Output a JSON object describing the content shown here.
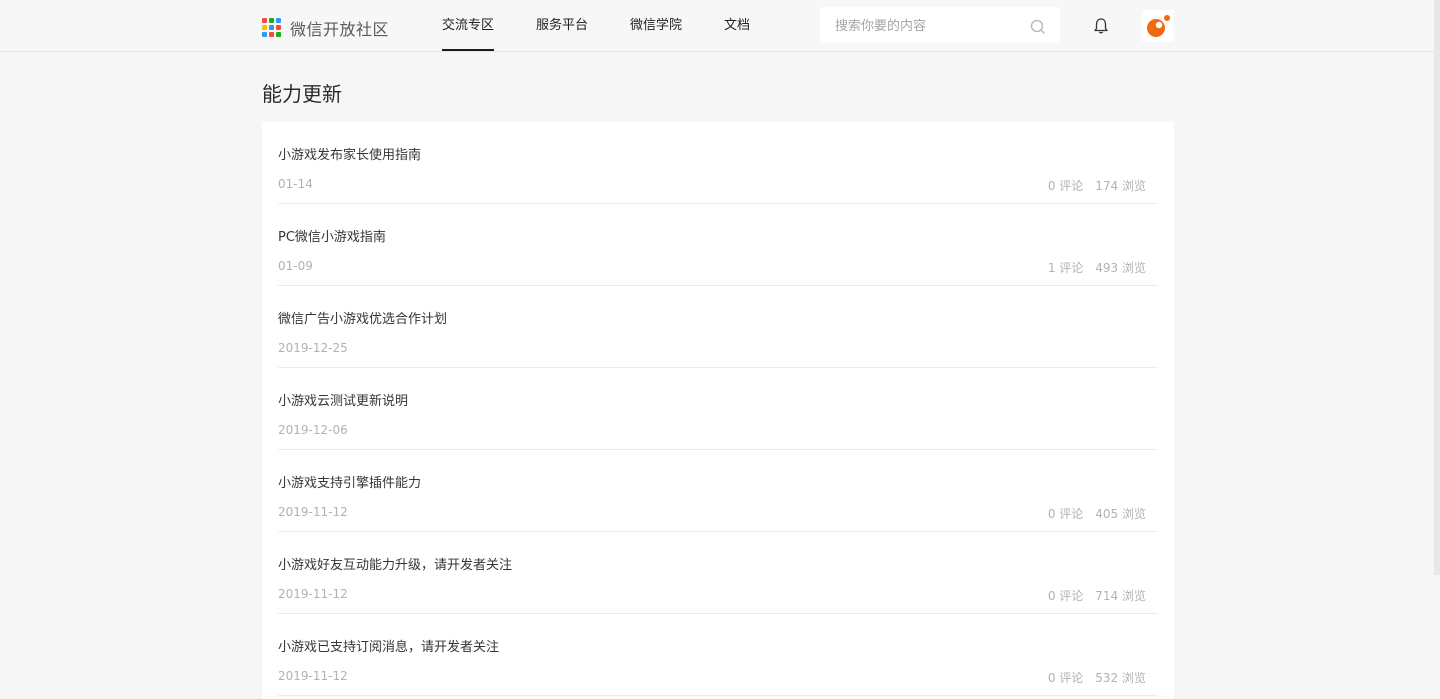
{
  "header": {
    "logo_text": "微信开放社区",
    "nav": [
      "交流专区",
      "服务平台",
      "微信学院",
      "文档"
    ],
    "search_placeholder": "搜索你要的内容"
  },
  "page": {
    "title": "能力更新"
  },
  "posts": [
    {
      "title": "小游戏发布家长使用指南",
      "date": "01-14",
      "comments": "0 评论",
      "views": "174 浏览"
    },
    {
      "title": "PC微信小游戏指南",
      "date": "01-09",
      "comments": "1 评论",
      "views": "493 浏览"
    },
    {
      "title": "微信广告小游戏优选合作计划",
      "date": "2019-12-25",
      "comments": "",
      "views": ""
    },
    {
      "title": "小游戏云测试更新说明",
      "date": "2019-12-06",
      "comments": "",
      "views": ""
    },
    {
      "title": "小游戏支持引擎插件能力",
      "date": "2019-11-12",
      "comments": "0 评论",
      "views": "405 浏览"
    },
    {
      "title": "小游戏好友互动能力升级，请开发者关注",
      "date": "2019-11-12",
      "comments": "0 评论",
      "views": "714 浏览"
    },
    {
      "title": "小游戏已支持订阅消息，请开发者关注",
      "date": "2019-11-12",
      "comments": "0 评论",
      "views": "532 浏览"
    }
  ],
  "colors": {
    "background": "#f6f6f6",
    "card": "#ffffff",
    "avatar_accent": "#f06a0f"
  }
}
